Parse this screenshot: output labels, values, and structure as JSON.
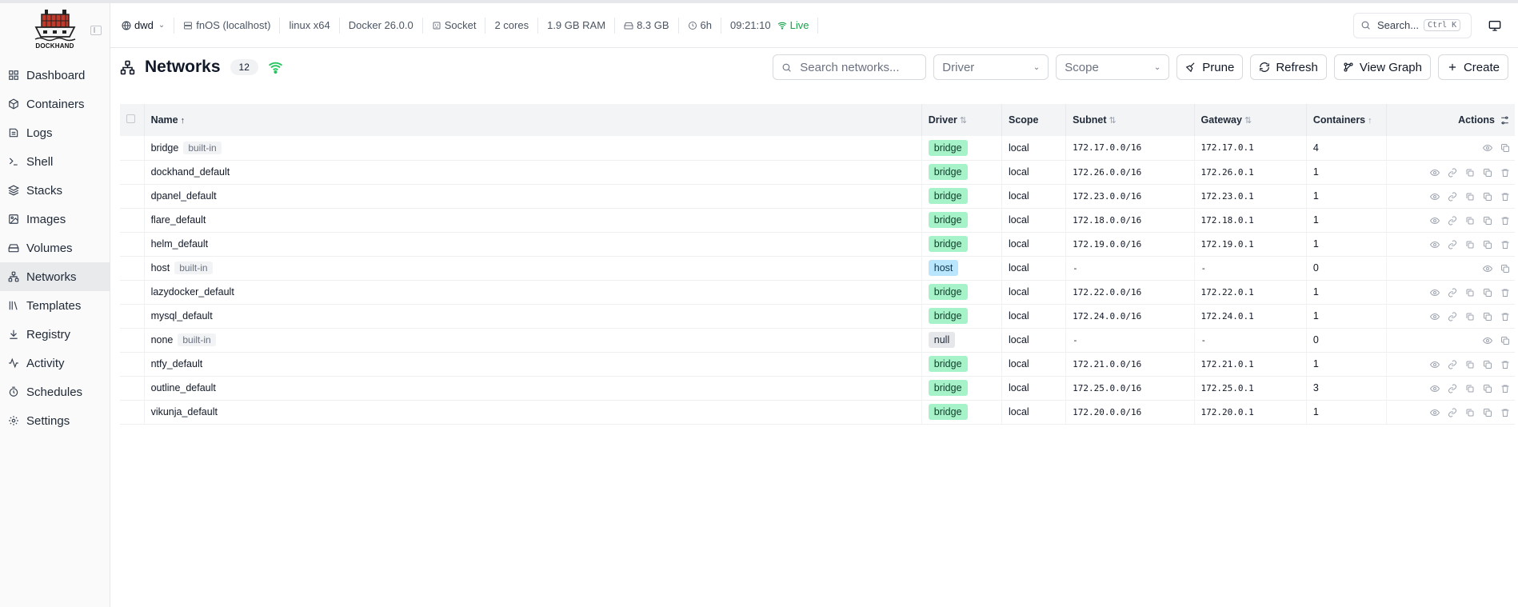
{
  "sidebar": {
    "logo_text": "DOCKHAND",
    "items": [
      {
        "label": "Dashboard",
        "icon": "dashboard-icon"
      },
      {
        "label": "Containers",
        "icon": "box-icon"
      },
      {
        "label": "Logs",
        "icon": "logs-icon"
      },
      {
        "label": "Shell",
        "icon": "terminal-icon"
      },
      {
        "label": "Stacks",
        "icon": "layers-icon"
      },
      {
        "label": "Images",
        "icon": "images-icon"
      },
      {
        "label": "Volumes",
        "icon": "drive-icon"
      },
      {
        "label": "Networks",
        "icon": "network-icon",
        "active": true
      },
      {
        "label": "Templates",
        "icon": "library-icon"
      },
      {
        "label": "Registry",
        "icon": "download-icon"
      },
      {
        "label": "Activity",
        "icon": "activity-icon"
      },
      {
        "label": "Schedules",
        "icon": "timer-icon"
      },
      {
        "label": "Settings",
        "icon": "gear-icon"
      }
    ]
  },
  "topbar": {
    "environment": "dwd",
    "host": "fnOS (localhost)",
    "platform": "linux x64",
    "docker": "Docker 26.0.0",
    "connection": "Socket",
    "cores": "2 cores",
    "ram": "1.9 GB RAM",
    "disk": "8.3 GB",
    "uptime": "6h",
    "time": "09:21:10",
    "live": "Live",
    "search_label": "Search...",
    "search_kbd": "Ctrl K"
  },
  "page": {
    "title": "Networks",
    "count": "12",
    "search_placeholder": "Search networks...",
    "driver_placeholder": "Driver",
    "scope_placeholder": "Scope",
    "prune_label": "Prune",
    "refresh_label": "Refresh",
    "view_graph_label": "View Graph",
    "create_label": "Create"
  },
  "table": {
    "columns": {
      "name": "Name",
      "driver": "Driver",
      "scope": "Scope",
      "subnet": "Subnet",
      "gateway": "Gateway",
      "containers": "Containers",
      "actions": "Actions"
    },
    "builtin_label": "built-in",
    "rows": [
      {
        "name": "bridge",
        "builtin": true,
        "driver": "bridge",
        "scope": "local",
        "subnet": "172.17.0.0/16",
        "gateway": "172.17.0.1",
        "containers": "4"
      },
      {
        "name": "dockhand_default",
        "builtin": false,
        "driver": "bridge",
        "scope": "local",
        "subnet": "172.26.0.0/16",
        "gateway": "172.26.0.1",
        "containers": "1"
      },
      {
        "name": "dpanel_default",
        "builtin": false,
        "driver": "bridge",
        "scope": "local",
        "subnet": "172.23.0.0/16",
        "gateway": "172.23.0.1",
        "containers": "1"
      },
      {
        "name": "flare_default",
        "builtin": false,
        "driver": "bridge",
        "scope": "local",
        "subnet": "172.18.0.0/16",
        "gateway": "172.18.0.1",
        "containers": "1"
      },
      {
        "name": "helm_default",
        "builtin": false,
        "driver": "bridge",
        "scope": "local",
        "subnet": "172.19.0.0/16",
        "gateway": "172.19.0.1",
        "containers": "1"
      },
      {
        "name": "host",
        "builtin": true,
        "driver": "host",
        "scope": "local",
        "subnet": "-",
        "gateway": "-",
        "containers": "0"
      },
      {
        "name": "lazydocker_default",
        "builtin": false,
        "driver": "bridge",
        "scope": "local",
        "subnet": "172.22.0.0/16",
        "gateway": "172.22.0.1",
        "containers": "1"
      },
      {
        "name": "mysql_default",
        "builtin": false,
        "driver": "bridge",
        "scope": "local",
        "subnet": "172.24.0.0/16",
        "gateway": "172.24.0.1",
        "containers": "1"
      },
      {
        "name": "none",
        "builtin": true,
        "driver": "null",
        "scope": "local",
        "subnet": "-",
        "gateway": "-",
        "containers": "0"
      },
      {
        "name": "ntfy_default",
        "builtin": false,
        "driver": "bridge",
        "scope": "local",
        "subnet": "172.21.0.0/16",
        "gateway": "172.21.0.1",
        "containers": "1"
      },
      {
        "name": "outline_default",
        "builtin": false,
        "driver": "bridge",
        "scope": "local",
        "subnet": "172.25.0.0/16",
        "gateway": "172.25.0.1",
        "containers": "3"
      },
      {
        "name": "vikunja_default",
        "builtin": false,
        "driver": "bridge",
        "scope": "local",
        "subnet": "172.20.0.0/16",
        "gateway": "172.20.0.1",
        "containers": "1"
      }
    ]
  }
}
